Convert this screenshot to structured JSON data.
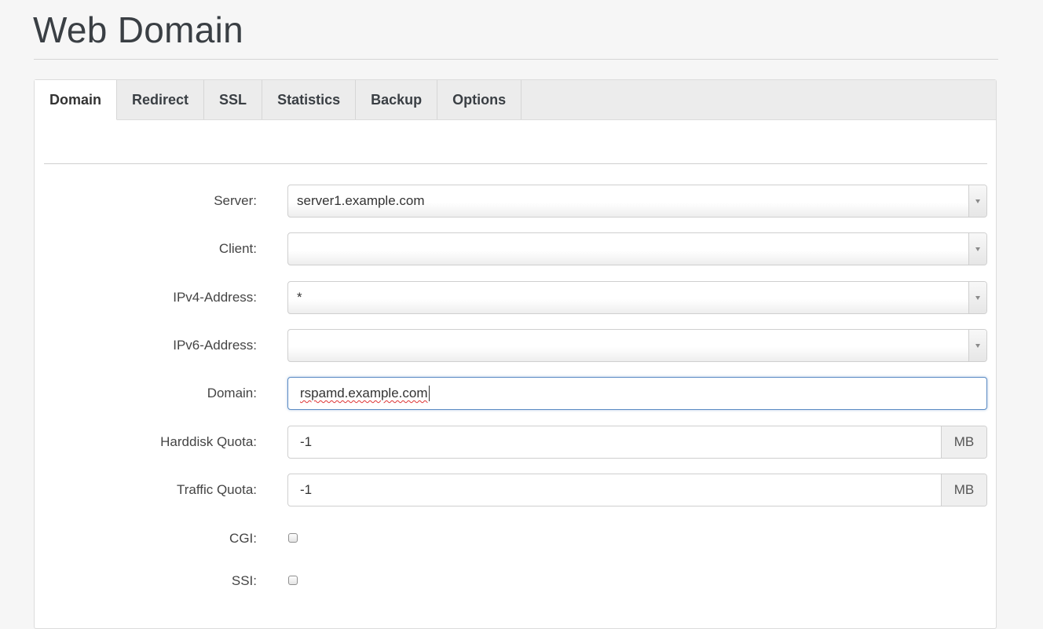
{
  "page": {
    "title": "Web Domain"
  },
  "tabs": [
    {
      "label": "Domain",
      "active": true
    },
    {
      "label": "Redirect",
      "active": false
    },
    {
      "label": "SSL",
      "active": false
    },
    {
      "label": "Statistics",
      "active": false
    },
    {
      "label": "Backup",
      "active": false
    },
    {
      "label": "Options",
      "active": false
    }
  ],
  "form": {
    "server": {
      "label": "Server:",
      "value": "server1.example.com"
    },
    "client": {
      "label": "Client:",
      "value": ""
    },
    "ipv4": {
      "label": "IPv4-Address:",
      "value": "*"
    },
    "ipv6": {
      "label": "IPv6-Address:",
      "value": ""
    },
    "domain": {
      "label": "Domain:",
      "value": "rspamd.example.com"
    },
    "harddisk_quota": {
      "label": "Harddisk Quota:",
      "value": "-1",
      "unit": "MB"
    },
    "traffic_quota": {
      "label": "Traffic Quota:",
      "value": "-1",
      "unit": "MB"
    },
    "cgi": {
      "label": "CGI:",
      "checked": false
    },
    "ssi": {
      "label": "SSI:",
      "checked": false
    }
  },
  "icons": {
    "select_caret": "chevron-down-icon"
  },
  "colors": {
    "focus_border": "#5b8bc4",
    "background": "#f6f6f6"
  }
}
